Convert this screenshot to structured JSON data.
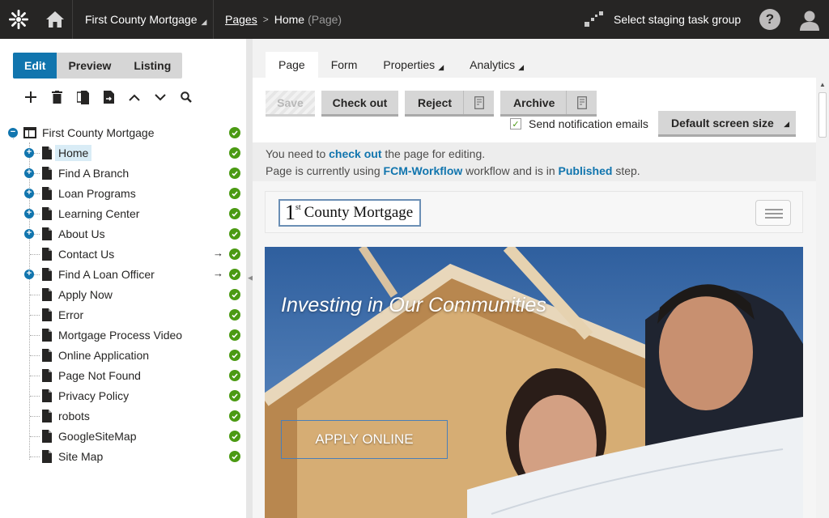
{
  "header": {
    "site_name": "First County Mortgage",
    "breadcrumb_link": "Pages",
    "breadcrumb_current": "Home",
    "breadcrumb_type": "(Page)",
    "staging_label": "Select staging task group",
    "help_label": "?"
  },
  "modes": [
    {
      "label": "Edit",
      "active": true
    },
    {
      "label": "Preview",
      "active": false
    },
    {
      "label": "Listing",
      "active": false
    }
  ],
  "toolbar_icons": [
    "add-icon",
    "delete-icon",
    "copy-icon",
    "move-icon",
    "up-icon",
    "down-icon",
    "search-icon"
  ],
  "tree": {
    "root": "First County Mortgage",
    "items": [
      {
        "label": "Home",
        "expander": "+",
        "selected": true,
        "arrow": false
      },
      {
        "label": "Find A Branch",
        "expander": "+",
        "selected": false,
        "arrow": false
      },
      {
        "label": "Loan Programs",
        "expander": "+",
        "selected": false,
        "arrow": false
      },
      {
        "label": "Learning Center",
        "expander": "+",
        "selected": false,
        "arrow": false
      },
      {
        "label": "About Us",
        "expander": "+",
        "selected": false,
        "arrow": false
      },
      {
        "label": "Contact Us",
        "expander": "",
        "selected": false,
        "arrow": true
      },
      {
        "label": "Find A Loan Officer",
        "expander": "+",
        "selected": false,
        "arrow": true
      },
      {
        "label": "Apply Now",
        "expander": "",
        "selected": false,
        "arrow": false
      },
      {
        "label": "Error",
        "expander": "",
        "selected": false,
        "arrow": false
      },
      {
        "label": "Mortgage Process Video",
        "expander": "",
        "selected": false,
        "arrow": false
      },
      {
        "label": "Online Application",
        "expander": "",
        "selected": false,
        "arrow": false
      },
      {
        "label": "Page Not Found",
        "expander": "",
        "selected": false,
        "arrow": false
      },
      {
        "label": "Privacy Policy",
        "expander": "",
        "selected": false,
        "arrow": false
      },
      {
        "label": "robots",
        "expander": "",
        "selected": false,
        "arrow": false
      },
      {
        "label": "GoogleSiteMap",
        "expander": "",
        "selected": false,
        "arrow": false
      },
      {
        "label": "Site Map",
        "expander": "",
        "selected": false,
        "arrow": false
      }
    ],
    "arrow_glyph": "→"
  },
  "tabs": [
    {
      "label": "Page",
      "active": true,
      "caret": false
    },
    {
      "label": "Form",
      "active": false,
      "caret": false
    },
    {
      "label": "Properties",
      "active": false,
      "caret": true
    },
    {
      "label": "Analytics",
      "active": false,
      "caret": true
    }
  ],
  "actions": {
    "save": "Save",
    "checkout": "Check out",
    "reject": "Reject",
    "archive": "Archive",
    "notify_label": "Send notification emails",
    "notify_checked": true,
    "screen_size": "Default screen size"
  },
  "info": {
    "line1_a": "You need to ",
    "line1_link": "check out",
    "line1_b": " the page for editing.",
    "line2_a": "Page is currently using ",
    "line2_workflow": "FCM-Workflow",
    "line2_b": " workflow and is in ",
    "line2_step": "Published",
    "line2_c": " step."
  },
  "preview": {
    "logo_one": "1",
    "logo_st": "st",
    "logo_text": "County Mortgage",
    "hero_title": "Investing in Our Communities",
    "apply_button": "APPLY ONLINE"
  },
  "colors": {
    "accent": "#1175ae",
    "status_ok": "#4b9a13",
    "header_bg": "#262524"
  }
}
